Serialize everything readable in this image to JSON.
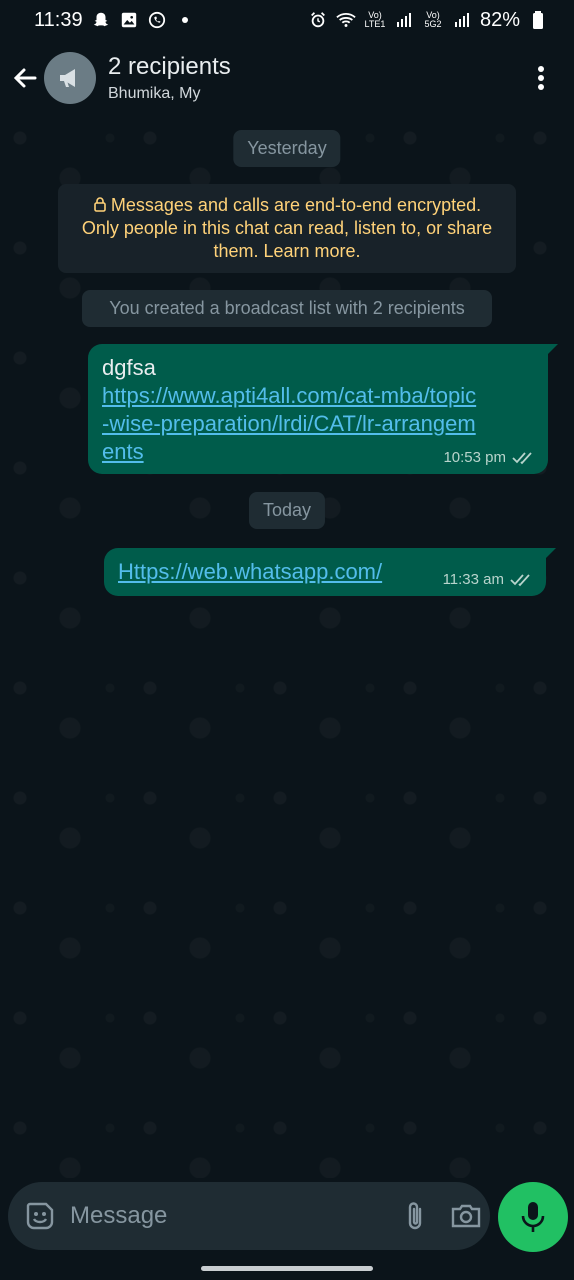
{
  "status_bar": {
    "time": "11:39",
    "battery": "82%",
    "net1": "Vo) LTE1",
    "net2": "Vo) 5G2"
  },
  "header": {
    "title": "2 recipients",
    "subtitle": "Bhumika, My"
  },
  "chat": {
    "date_yesterday": "Yesterday",
    "encryption_note": "Messages and calls are end-to-end encrypted. Only people in this chat can read, listen to, or share them. Learn more.",
    "system_note": "You created a broadcast list with 2 recipients",
    "date_today": "Today",
    "messages": [
      {
        "text": "dgfsa",
        "link": "https://www.apti4all.com/cat-mba/topic-wise-preparation/lrdi/CAT/lr-arrangements",
        "time": "10:53 pm"
      },
      {
        "link": "Https://web.whatsapp.com/",
        "time": "11:33 am"
      }
    ]
  },
  "composer": {
    "placeholder": "Message"
  },
  "colors": {
    "background": "#0b141a",
    "outgoing_bubble": "#005c4b",
    "link": "#53bdeb",
    "accent": "#21c063",
    "encryption_text": "#ffd279"
  }
}
